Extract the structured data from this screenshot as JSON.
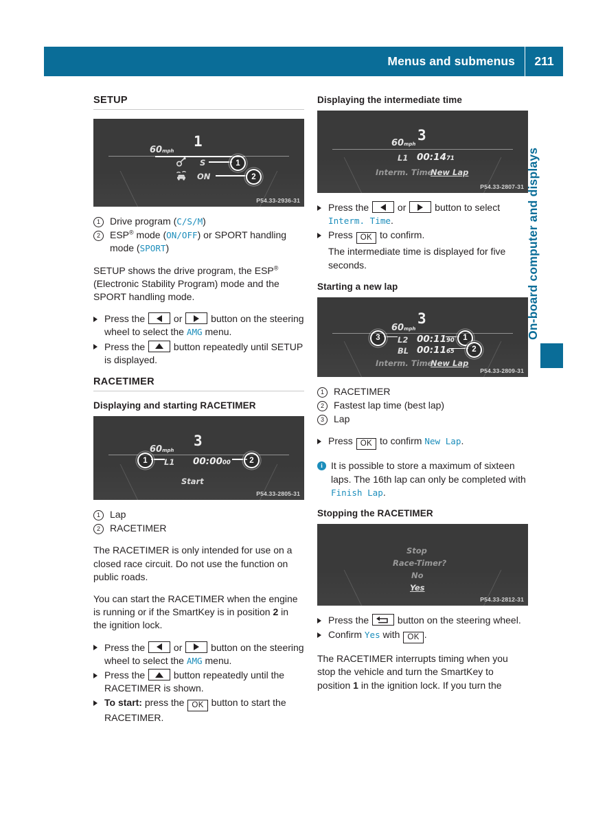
{
  "header": {
    "title": "Menus and submenus",
    "page_number": "211"
  },
  "side_tab": {
    "label": "On-board computer and displays"
  },
  "left_column": {
    "section_title": "SETUP",
    "figure_setup": {
      "code": "P54.33-2936-31",
      "gear": "1",
      "speed": "60",
      "speed_unit": "mph",
      "drive_program": "S",
      "esp_state": "ON",
      "callouts": [
        "1",
        "2"
      ]
    },
    "legend_setup": [
      {
        "num": "1",
        "pre": "Drive program (",
        "code": "C/S/M",
        "post": ")"
      },
      {
        "num": "2",
        "pre": "ESP",
        "sup": "®",
        "mid": " mode (",
        "code": "ON/OFF",
        "mid2": ") or SPORT handling mode (",
        "code2": "SPORT",
        "post": ")"
      }
    ],
    "para_setup_1a": "SETUP shows the drive program, the ESP",
    "para_setup_1sup": "®",
    "para_setup_1b": " (Electronic Stability Program) mode and the SPORT handling mode.",
    "instr_setup": [
      {
        "pre": "Press the ",
        "key1": "arrow-left",
        "mid": " or ",
        "key2": "arrow-right",
        "post": " button on the steering wheel to select the ",
        "code": "AMG",
        "tail": " menu."
      },
      {
        "pre": "Press the ",
        "key1": "arrow-up",
        "post": " button repeatedly until SETUP is displayed."
      }
    ],
    "racetimer_title": "RACETIMER",
    "racetimer_sub": "Displaying and starting RACETIMER",
    "figure_racetimer": {
      "code": "P54.33-2805-31",
      "gear": "3",
      "speed": "60",
      "speed_unit": "mph",
      "lap_label": "L1",
      "time": "00:00",
      "time_cs": "00",
      "start_label": "Start",
      "callouts": [
        "1",
        "2"
      ]
    },
    "legend_racetimer": [
      {
        "num": "1",
        "text": "Lap"
      },
      {
        "num": "2",
        "text": "RACETIMER"
      }
    ],
    "para_rt_1": "The RACETIMER is only intended for use on a closed race circuit. Do not use the function on public roads.",
    "para_rt_2a": "You can start the RACETIMER when the engine is running or if the SmartKey is in position ",
    "para_rt_2bold": "2",
    "para_rt_2b": " in the ignition lock.",
    "instr_rt": [
      {
        "pre": "Press the ",
        "key1": "arrow-left",
        "mid": " or ",
        "key2": "arrow-right",
        "post": " button on the steering wheel to select the ",
        "code": "AMG",
        "tail": " menu."
      },
      {
        "pre": "Press the ",
        "key1": "arrow-up",
        "post": " button repeatedly until the RACETIMER is shown."
      },
      {
        "bold": "To start:",
        "pre": " press the ",
        "key1": "ok",
        "post": " button to start the RACETIMER."
      }
    ]
  },
  "right_column": {
    "intermediate_title": "Displaying the intermediate time",
    "figure_intermediate": {
      "code": "P54.33-2807-31",
      "gear": "3",
      "speed": "60",
      "speed_unit": "mph",
      "lap_label": "L1",
      "time": "00:14",
      "time_cs": "71",
      "menu_left": "Interm. Time",
      "menu_right": "New Lap"
    },
    "instr_intermediate": [
      {
        "pre": "Press the ",
        "key1": "arrow-left",
        "mid": " or ",
        "key2": "arrow-right",
        "post": " button to select ",
        "code": "Interm. Time",
        "tail": "."
      },
      {
        "pre": "Press ",
        "key1": "ok",
        "post": " to confirm."
      }
    ],
    "instr_intermediate_follow": "The intermediate time is displayed for five seconds.",
    "newlap_title": "Starting a new lap",
    "figure_newlap": {
      "code": "P54.33-2809-31",
      "gear": "3",
      "speed": "60",
      "speed_unit": "mph",
      "lap_label": "L2",
      "lap_time": "00:11",
      "lap_time_cs": "90",
      "best_label": "BL",
      "best_time": "00:11",
      "best_time_cs": "65",
      "menu_left": "Interm. Time",
      "menu_right": "New Lap",
      "callouts": [
        "3",
        "1",
        "2"
      ]
    },
    "legend_newlap": [
      {
        "num": "1",
        "text": "RACETIMER"
      },
      {
        "num": "2",
        "text": "Fastest lap time (best lap)"
      },
      {
        "num": "3",
        "text": "Lap"
      }
    ],
    "instr_newlap": [
      {
        "pre": "Press ",
        "key1": "ok",
        "post": " to confirm ",
        "code": "New Lap",
        "tail": "."
      }
    ],
    "note": {
      "icon": "info-icon",
      "pre": "It is possible to store a maximum of sixteen laps. The 16th lap can only be completed with ",
      "code": "Finish Lap",
      "post": "."
    },
    "stopping_title": "Stopping the RACETIMER",
    "figure_stopping": {
      "code": "P54.33-2812-31",
      "line1": "Stop",
      "line2": "Race-Timer?",
      "line3": "No",
      "line4": "Yes"
    },
    "instr_stopping": [
      {
        "pre": "Press the ",
        "key1": "back",
        "post": " button on the steering wheel."
      },
      {
        "pre": "Confirm ",
        "code": "Yes",
        "mid": " with ",
        "key1": "ok",
        "post": "."
      }
    ],
    "para_stop_a": "The RACETIMER interrupts timing when you stop the vehicle and turn the SmartKey to position ",
    "para_stop_bold": "1",
    "para_stop_b": " in the ignition lock. If you turn the"
  },
  "colors": {
    "accent": "#0a6d98",
    "link": "#1b8dbb",
    "text": "#231f20",
    "rule": "#c9c9c9",
    "screen_bg": "#3a3a3a"
  }
}
